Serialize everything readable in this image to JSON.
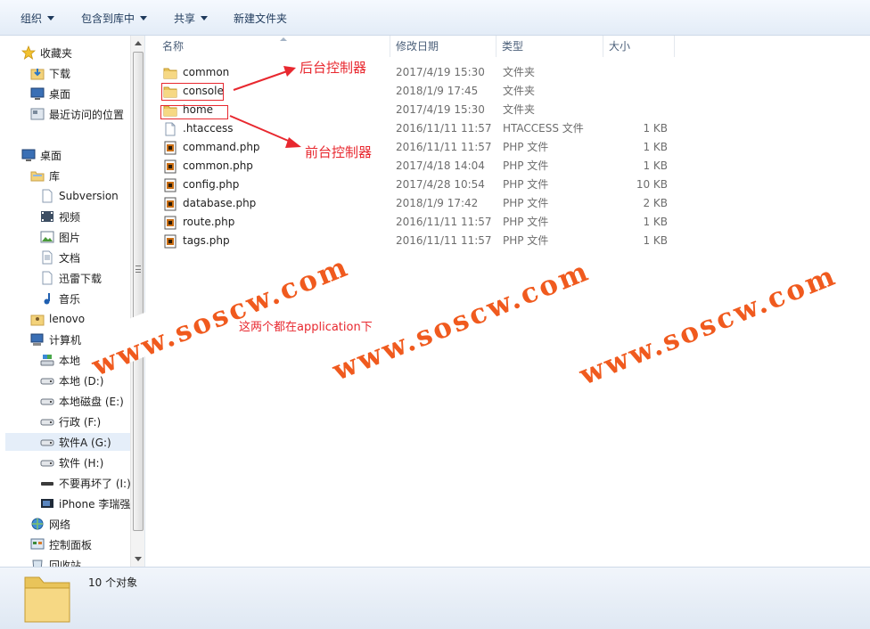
{
  "toolbar": {
    "organize": "组织",
    "include_in_library": "包含到库中",
    "share": "共享",
    "new_folder": "新建文件夹"
  },
  "nav": {
    "favorites": "收藏夹",
    "downloads": "下载",
    "desktop_fav": "桌面",
    "recent": "最近访问的位置",
    "desktop": "桌面",
    "libraries": "库",
    "subversion": "Subversion",
    "video": "视频",
    "pictures": "图片",
    "documents": "文档",
    "thunder": "迅雷下载",
    "music": "音乐",
    "lenovo": "lenovo",
    "computer": "计算机",
    "local_c": "本地",
    "local_d": "本地    (D:)",
    "local_e": "本地磁盘 (E:)",
    "drive_f": "行政 (F:)",
    "drive_g": "软件A (G:)",
    "drive_h": "软件 (H:)",
    "drive_i": "不要再坏了 (I:)",
    "iphone": "iPhone 李瑞强",
    "network": "网络",
    "control_panel": "控制面板",
    "recycle": "回收站"
  },
  "columns": {
    "name": "名称",
    "date": "修改日期",
    "type": "类型",
    "size": "大小"
  },
  "files": [
    {
      "name": "common",
      "date": "2017/4/19 15:30",
      "type": "文件夹",
      "size": "",
      "icon": "folder-icon"
    },
    {
      "name": "console",
      "date": "2018/1/9 17:45",
      "type": "文件夹",
      "size": "",
      "icon": "folder-icon"
    },
    {
      "name": "home",
      "date": "2017/4/19 15:30",
      "type": "文件夹",
      "size": "",
      "icon": "folder-icon"
    },
    {
      "name": ".htaccess",
      "date": "2016/11/11 11:57",
      "type": "HTACCESS 文件",
      "size": "1 KB",
      "icon": "blank-file-icon"
    },
    {
      "name": "command.php",
      "date": "2016/11/11 11:57",
      "type": "PHP 文件",
      "size": "1 KB",
      "icon": "php-file-icon"
    },
    {
      "name": "common.php",
      "date": "2017/4/18 14:04",
      "type": "PHP 文件",
      "size": "1 KB",
      "icon": "php-file-icon"
    },
    {
      "name": "config.php",
      "date": "2017/4/28 10:54",
      "type": "PHP 文件",
      "size": "10 KB",
      "icon": "php-file-icon"
    },
    {
      "name": "database.php",
      "date": "2018/1/9 17:42",
      "type": "PHP 文件",
      "size": "2 KB",
      "icon": "php-file-icon"
    },
    {
      "name": "route.php",
      "date": "2016/11/11 11:57",
      "type": "PHP 文件",
      "size": "1 KB",
      "icon": "php-file-icon"
    },
    {
      "name": "tags.php",
      "date": "2016/11/11 11:57",
      "type": "PHP 文件",
      "size": "1 KB",
      "icon": "php-file-icon"
    }
  ],
  "status": {
    "count": "10 个对象"
  },
  "annotations": {
    "backend": "后台控制器",
    "frontend": "前台控制器",
    "application_note": "这两个都在application下",
    "color": "#e8282f"
  },
  "watermark": {
    "text": "www.soscw.com",
    "color": "#f05a1e"
  }
}
